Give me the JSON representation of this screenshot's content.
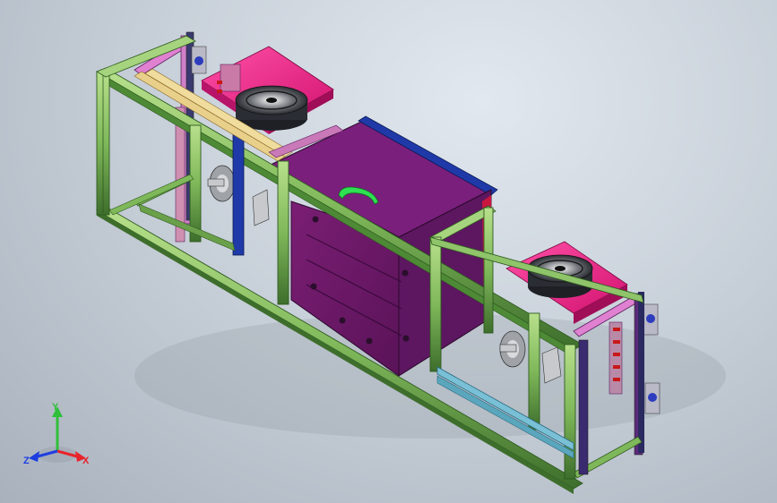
{
  "viewport": {
    "background_top": "#e2e8ef",
    "background_bottom": "#a9b1bd"
  },
  "model": {
    "description_colors": {
      "frame_green": "#8fc46a",
      "frame_dark": "#3a6b2a",
      "panel_purple": "#6b1f6e",
      "panel_magenta": "#ef1f8c",
      "bar_blue": "#1f3aa8",
      "rail_cyan": "#79c0d6",
      "handle_green": "#2fe052"
    }
  },
  "triad": {
    "x_label": "X",
    "y_label": "Y",
    "z_label": "Z",
    "x_color": "#e8242c",
    "y_color": "#2fbf3a",
    "z_color": "#1e3ee0"
  }
}
